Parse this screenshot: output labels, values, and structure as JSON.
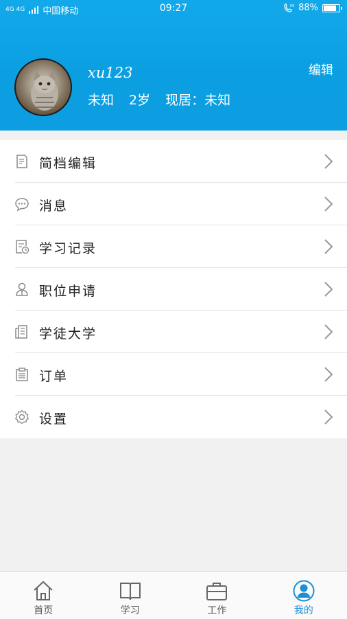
{
  "status_bar": {
    "network": "4G 4G",
    "carrier": "中国移动",
    "time": "09:27",
    "battery": "88%",
    "battery_level": 0.88
  },
  "profile": {
    "username": "xu123",
    "gender": "未知",
    "age": "2岁",
    "location": "现居：未知",
    "edit_label": "编辑"
  },
  "menu": {
    "items": [
      {
        "label": "简档编辑",
        "icon": "resume-edit-icon"
      },
      {
        "label": "消息",
        "icon": "message-icon"
      },
      {
        "label": "学习记录",
        "icon": "study-record-icon"
      },
      {
        "label": "职位申请",
        "icon": "job-application-icon"
      },
      {
        "label": "学徒大学",
        "icon": "university-icon"
      },
      {
        "label": "订单",
        "icon": "order-icon"
      },
      {
        "label": "设置",
        "icon": "settings-icon"
      }
    ]
  },
  "tabbar": {
    "tabs": [
      {
        "label": "首页",
        "icon": "home-icon"
      },
      {
        "label": "学习",
        "icon": "book-icon"
      },
      {
        "label": "工作",
        "icon": "briefcase-icon"
      },
      {
        "label": "我的",
        "icon": "user-icon"
      }
    ],
    "active_index": 3
  },
  "colors": {
    "header": "#0ea3e6",
    "accent": "#1a8fd6",
    "icon_gray": "#8a8a8a"
  }
}
